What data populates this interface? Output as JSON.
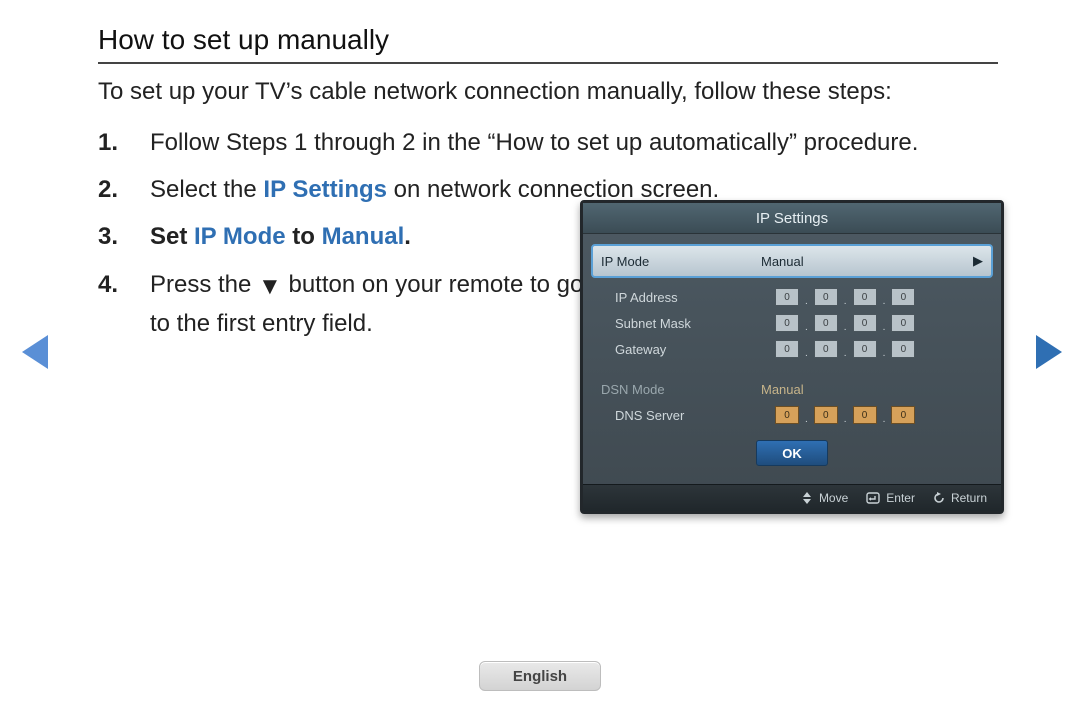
{
  "title": "How to set up manually",
  "intro": "To set up your TV’s cable network connection manually, follow these steps:",
  "steps": {
    "s1": {
      "text": "Follow Steps 1 through 2 in the “How to set up automatically” procedure."
    },
    "s2": {
      "pre": "Select the ",
      "kw": "IP Settings",
      "post": " on network connection screen."
    },
    "s3": {
      "pre": "Set ",
      "kw1": "IP Mode",
      "mid": " to ",
      "kw2": "Manual",
      "post": "."
    },
    "s4": {
      "pre": "Press the ",
      "tri": "▼",
      "post": " button on your remote to go to the first entry field."
    }
  },
  "osd": {
    "title": "IP Settings",
    "ip_mode": {
      "label": "IP Mode",
      "value": "Manual"
    },
    "ip_address": {
      "label": "IP Address",
      "o1": "0",
      "o2": "0",
      "o3": "0",
      "o4": "0"
    },
    "subnet": {
      "label": "Subnet Mask",
      "o1": "0",
      "o2": "0",
      "o3": "0",
      "o4": "0"
    },
    "gateway": {
      "label": "Gateway",
      "o1": "0",
      "o2": "0",
      "o3": "0",
      "o4": "0"
    },
    "dsn_mode": {
      "label": "DSN Mode",
      "value": "Manual"
    },
    "dns_server": {
      "label": "DNS Server",
      "o1": "0",
      "o2": "0",
      "o3": "0",
      "o4": "0"
    },
    "ok": "OK",
    "footer": {
      "move": "Move",
      "enter": "Enter",
      "return": "Return"
    }
  },
  "language_button": "English"
}
